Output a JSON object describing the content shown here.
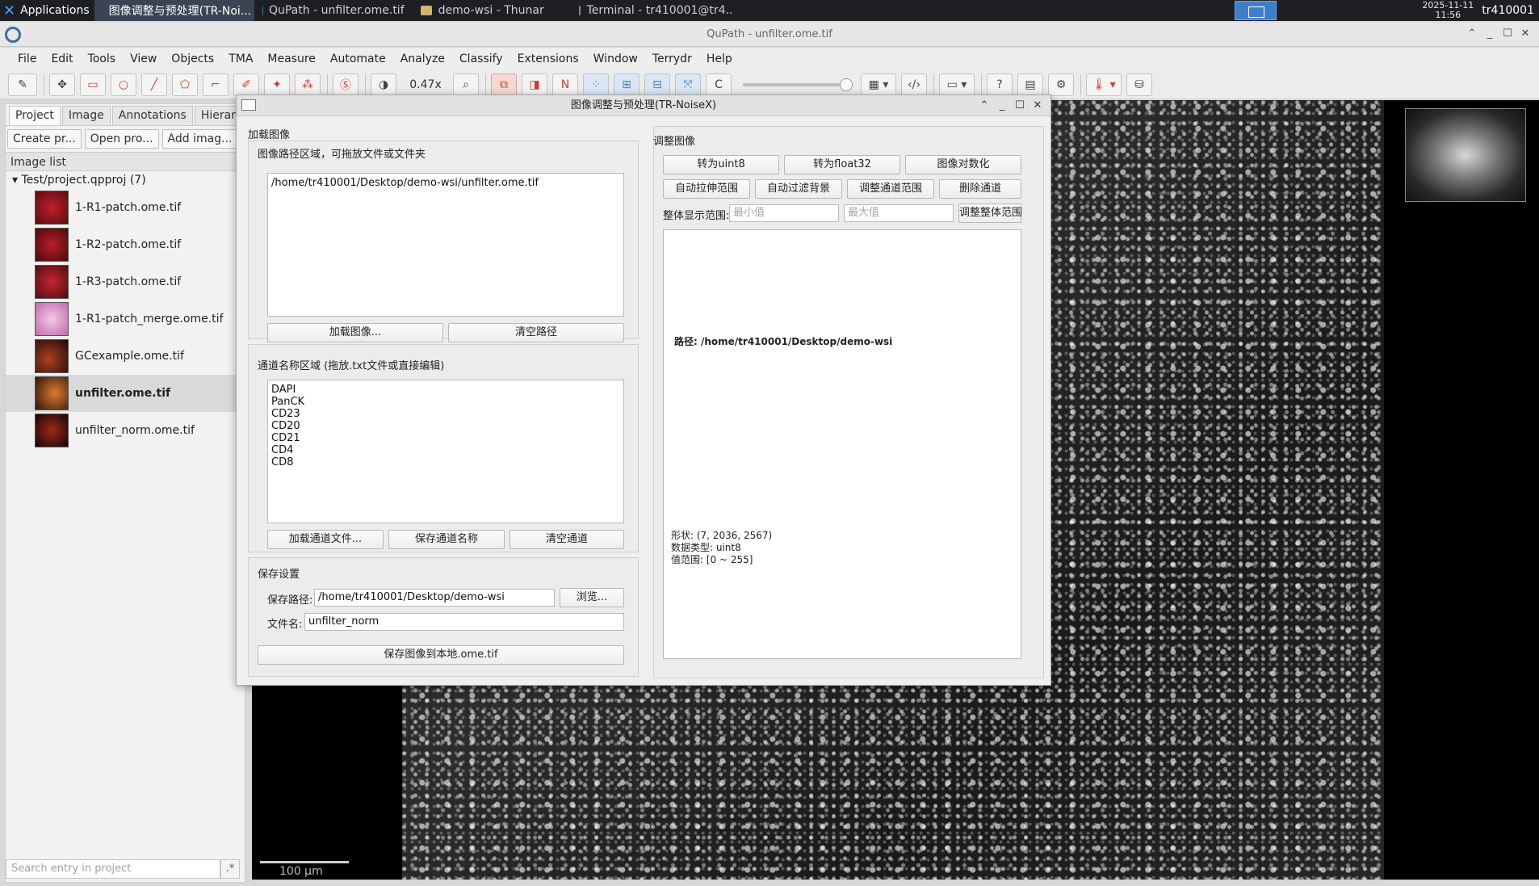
{
  "taskbar": {
    "apps_label": "Applications",
    "tasks": [
      {
        "label": "图像调整与预处理(TR-Noi..."
      },
      {
        "label": "QuPath - unfilter.ome.tif"
      },
      {
        "label": "demo-wsi - Thunar"
      },
      {
        "label": "Terminal - tr410001@tr4..."
      }
    ],
    "date": "2025-11-11",
    "time": "11:56",
    "user": "tr410001"
  },
  "window": {
    "title": "QuPath - unfilter.ome.tif"
  },
  "menu": [
    "File",
    "Edit",
    "Tools",
    "View",
    "Objects",
    "TMA",
    "Measure",
    "Automate",
    "Analyze",
    "Classify",
    "Extensions",
    "Window",
    "Terrydr",
    "Help"
  ],
  "toolbar": {
    "zoom": "0.47x",
    "n_label": "N",
    "c_label": "C"
  },
  "left": {
    "tabs": [
      "Project",
      "Image",
      "Annotations",
      "Hierarch"
    ],
    "buttons": [
      "Create pr...",
      "Open pro...",
      "Add imag..."
    ],
    "image_list_header": "Image list",
    "project_root": "Test/project.qpproj (7)",
    "images": [
      {
        "name": "1-R1-patch.ome.tif"
      },
      {
        "name": "1-R2-patch.ome.tif"
      },
      {
        "name": "1-R3-patch.ome.tif"
      },
      {
        "name": "1-R1-patch_merge.ome.tif"
      },
      {
        "name": "GCexample.ome.tif"
      },
      {
        "name": "unfilter.ome.tif"
      },
      {
        "name": "unfilter_norm.ome.tif"
      }
    ],
    "search_placeholder": "Search entry in project"
  },
  "viewer": {
    "scale_label": "100 µm"
  },
  "dialog": {
    "title": "图像调整与预处理(TR-NoiseX)",
    "load_section": "加载图像",
    "path_area_label": "图像路径区域，可拖放文件或文件夹",
    "path_text": "/home/tr410001/Desktop/demo-wsi/unfilter.ome.tif",
    "load_btn": "加载图像...",
    "clear_path_btn": "清空路径",
    "channel_area_label": "通道名称区域 (拖放.txt文件或直接编辑)",
    "channels": "DAPI\nPanCK\nCD23\nCD20\nCD21\nCD4\nCD8",
    "load_channel_btn": "加载通道文件...",
    "save_channel_btn": "保存通道名称",
    "clear_channel_btn": "清空通道",
    "save_section": "保存设置",
    "save_path_label": "保存路径:",
    "save_path": "/home/tr410001/Desktop/demo-wsi",
    "browse_btn": "浏览...",
    "filename_label": "文件名:",
    "filename": "unfilter_norm",
    "save_btn": "保存图像到本地.ome.tif",
    "adjust_section": "调整图像",
    "adjust_buttons_row1": [
      "转为uint8",
      "转为float32",
      "图像对数化"
    ],
    "adjust_buttons_row2": [
      "自动拉伸范围",
      "自动过滤背景",
      "调整通道范围",
      "删除通道"
    ],
    "display_range_label": "整体显示范围:",
    "min_placeholder": "最小值",
    "max_placeholder": "最大值",
    "adjust_range_btn": "调整整体范围",
    "info_path": "路径: /home/tr410001/Desktop/demo-wsi",
    "info_shape": "形状: (7, 2036, 2567)",
    "info_dtype": "数据类型: uint8",
    "info_range": "值范围: [0 ~ 255]"
  }
}
